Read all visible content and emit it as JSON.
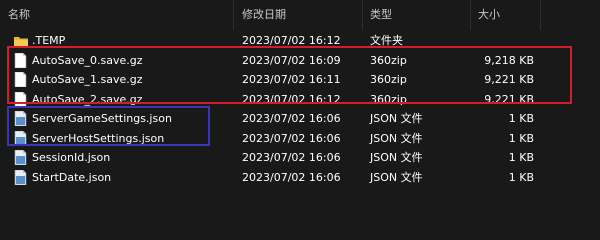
{
  "columns": {
    "name": "名称",
    "modified": "修改日期",
    "type": "类型",
    "size": "大小"
  },
  "files": [
    {
      "name": ".TEMP",
      "modified": "2023/07/02 16:12",
      "type": "文件夹",
      "size": "",
      "icon": "folder-icon"
    },
    {
      "name": "AutoSave_0.save.gz",
      "modified": "2023/07/02 16:09",
      "type": "360zip",
      "size": "9,218 KB",
      "icon": "document-icon"
    },
    {
      "name": "AutoSave_1.save.gz",
      "modified": "2023/07/02 16:11",
      "type": "360zip",
      "size": "9,221 KB",
      "icon": "document-icon"
    },
    {
      "name": "AutoSave_2.save.gz",
      "modified": "2023/07/02 16:12",
      "type": "360zip",
      "size": "9,221 KB",
      "icon": "document-icon"
    },
    {
      "name": "ServerGameSettings.json",
      "modified": "2023/07/02 16:06",
      "type": "JSON 文件",
      "size": "1 KB",
      "icon": "json-file-icon"
    },
    {
      "name": "ServerHostSettings.json",
      "modified": "2023/07/02 16:06",
      "type": "JSON 文件",
      "size": "1 KB",
      "icon": "json-file-icon"
    },
    {
      "name": "SessionId.json",
      "modified": "2023/07/02 16:06",
      "type": "JSON 文件",
      "size": "1 KB",
      "icon": "json-file-icon"
    },
    {
      "name": "StartDate.json",
      "modified": "2023/07/02 16:06",
      "type": "JSON 文件",
      "size": "1 KB",
      "icon": "json-file-icon"
    }
  ],
  "highlight_colors": {
    "red": "#d31c2c",
    "blue": "#3b34b8"
  }
}
